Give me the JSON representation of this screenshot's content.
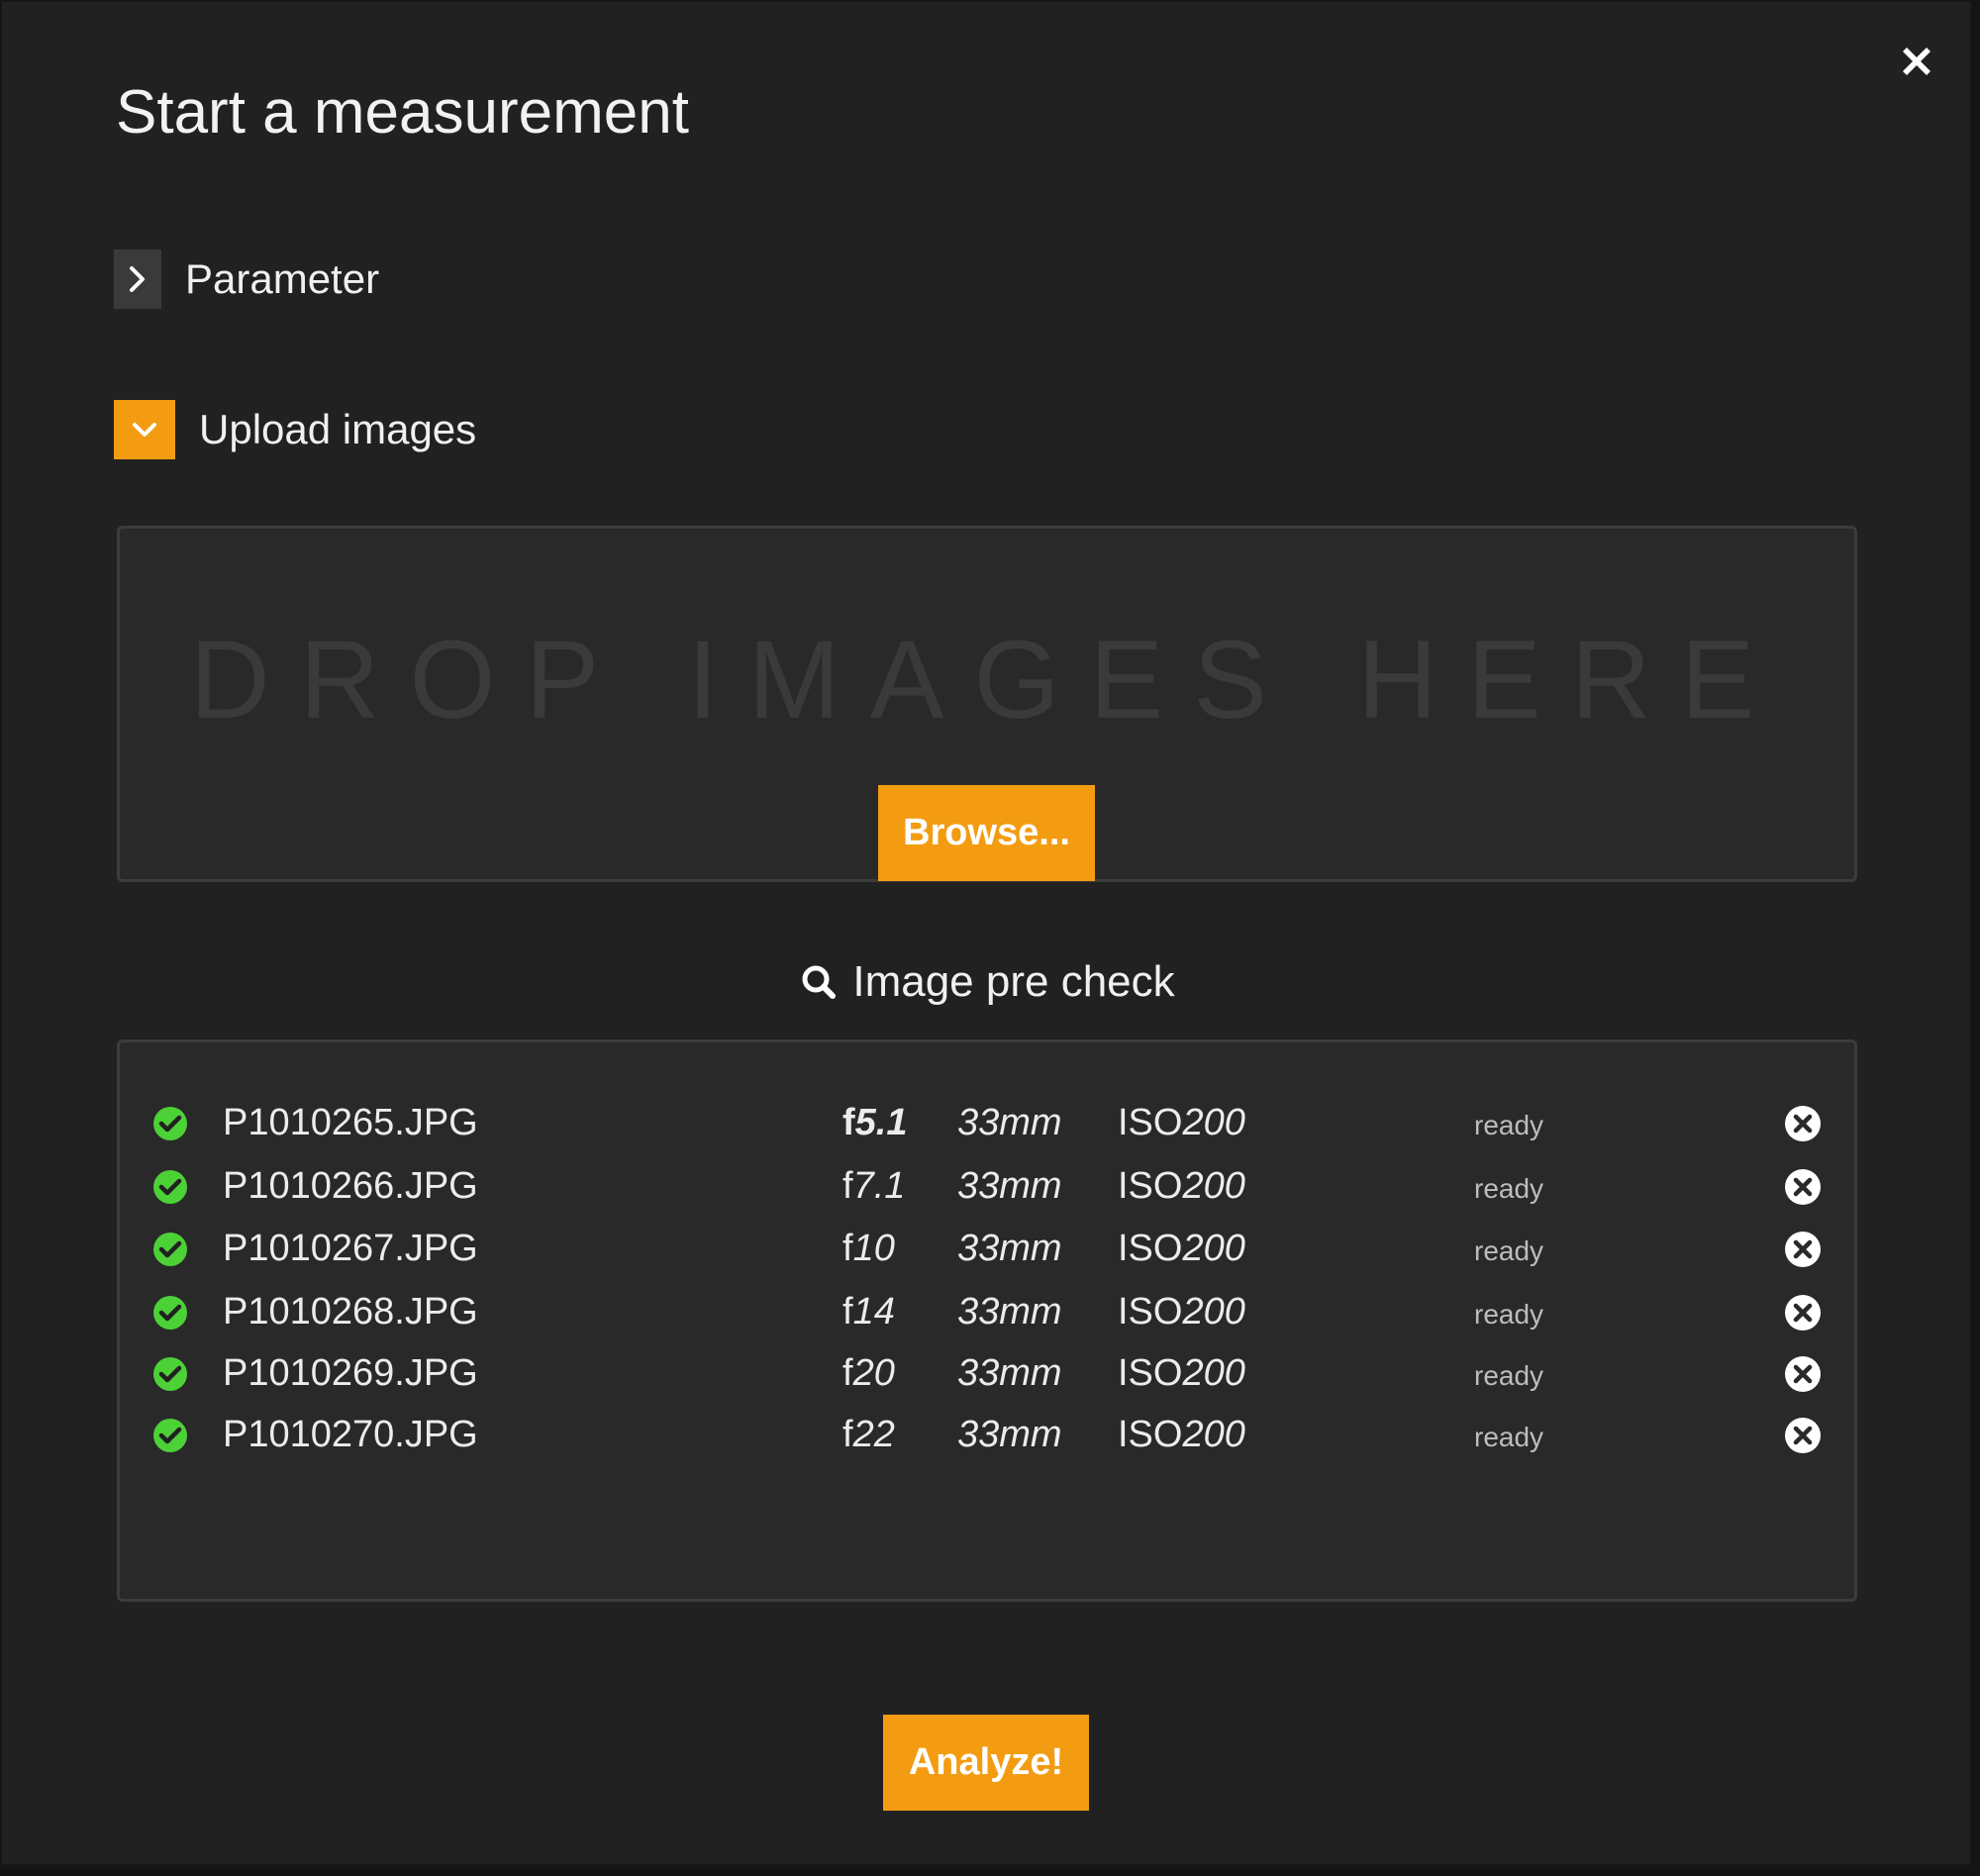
{
  "dialog": {
    "title": "Start a measurement",
    "close_icon": "close-icon"
  },
  "sections": {
    "parameter": {
      "label": "Parameter",
      "expanded": false,
      "toggle_icon": "chevron-right-icon"
    },
    "upload": {
      "label": "Upload images",
      "expanded": true,
      "toggle_icon": "chevron-down-icon"
    }
  },
  "dropzone": {
    "text": "DROP IMAGES HERE",
    "browse_label": "Browse..."
  },
  "precheck": {
    "icon": "search-icon",
    "label": "Image pre check",
    "files": [
      {
        "status_icon": "check-circle-icon",
        "name": "P1010265.JPG",
        "f_prefix": "f",
        "f_value": "5.1",
        "focal": "33mm",
        "iso_prefix": "ISO",
        "iso_value": "200",
        "status": "ready",
        "remove_icon": "remove-circle-icon"
      },
      {
        "status_icon": "check-circle-icon",
        "name": "P1010266.JPG",
        "f_prefix": "f",
        "f_value": "7.1",
        "focal": "33mm",
        "iso_prefix": "ISO",
        "iso_value": "200",
        "status": "ready",
        "remove_icon": "remove-circle-icon"
      },
      {
        "status_icon": "check-circle-icon",
        "name": "P1010267.JPG",
        "f_prefix": "f",
        "f_value": "10",
        "focal": "33mm",
        "iso_prefix": "ISO",
        "iso_value": "200",
        "status": "ready",
        "remove_icon": "remove-circle-icon"
      },
      {
        "status_icon": "check-circle-icon",
        "name": "P1010268.JPG",
        "f_prefix": "f",
        "f_value": "14",
        "focal": "33mm",
        "iso_prefix": "ISO",
        "iso_value": "200",
        "status": "ready",
        "remove_icon": "remove-circle-icon"
      },
      {
        "status_icon": "check-circle-icon",
        "name": "P1010269.JPG",
        "f_prefix": "f",
        "f_value": "20",
        "focal": "33mm",
        "iso_prefix": "ISO",
        "iso_value": "200",
        "status": "ready",
        "remove_icon": "remove-circle-icon"
      },
      {
        "status_icon": "check-circle-icon",
        "name": "P1010270.JPG",
        "f_prefix": "f",
        "f_value": "22",
        "focal": "33mm",
        "iso_prefix": "ISO",
        "iso_value": "200",
        "status": "ready",
        "remove_icon": "remove-circle-icon"
      }
    ]
  },
  "actions": {
    "analyze_label": "Analyze!"
  },
  "colors": {
    "background": "#212121",
    "panel": "#292929",
    "accent": "#f39c12",
    "success": "#4cd137",
    "text": "#f0f0f0",
    "muted": "#bdbdbd"
  }
}
